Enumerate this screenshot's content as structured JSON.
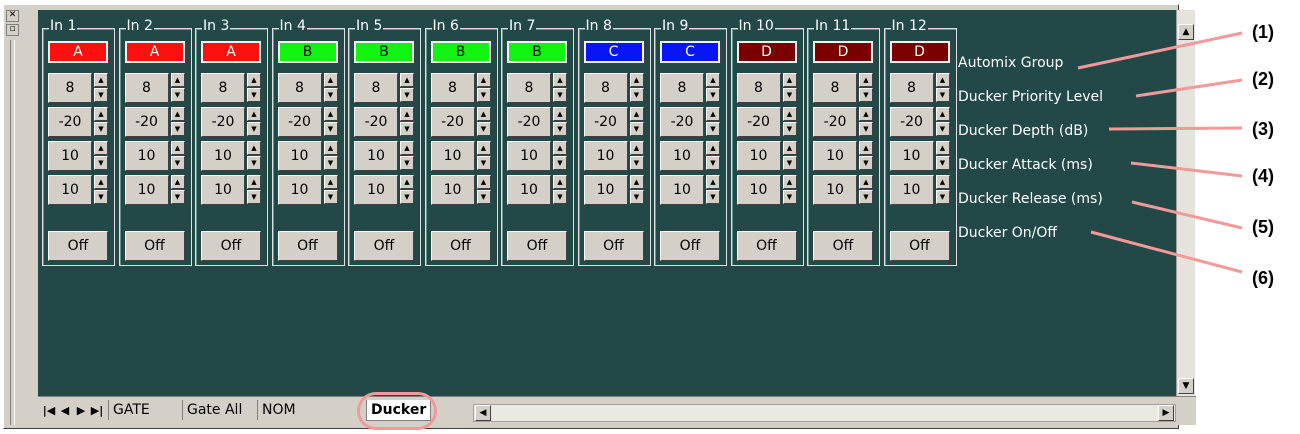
{
  "channels": [
    {
      "label": "In 1",
      "group": "A",
      "group_bg": "#ff1010",
      "group_fg": "#ffffff",
      "priority": "8",
      "depth": "-20",
      "attack": "10",
      "release": "10",
      "onoff": "Off"
    },
    {
      "label": "In 2",
      "group": "A",
      "group_bg": "#ff1010",
      "group_fg": "#ffffff",
      "priority": "8",
      "depth": "-20",
      "attack": "10",
      "release": "10",
      "onoff": "Off"
    },
    {
      "label": "In 3",
      "group": "A",
      "group_bg": "#ff1010",
      "group_fg": "#ffffff",
      "priority": "8",
      "depth": "-20",
      "attack": "10",
      "release": "10",
      "onoff": "Off"
    },
    {
      "label": "In 4",
      "group": "B",
      "group_bg": "#11f311",
      "group_fg": "#000000",
      "priority": "8",
      "depth": "-20",
      "attack": "10",
      "release": "10",
      "onoff": "Off"
    },
    {
      "label": "In 5",
      "group": "B",
      "group_bg": "#11f311",
      "group_fg": "#000000",
      "priority": "8",
      "depth": "-20",
      "attack": "10",
      "release": "10",
      "onoff": "Off"
    },
    {
      "label": "In 6",
      "group": "B",
      "group_bg": "#11f311",
      "group_fg": "#000000",
      "priority": "8",
      "depth": "-20",
      "attack": "10",
      "release": "10",
      "onoff": "Off"
    },
    {
      "label": "In 7",
      "group": "B",
      "group_bg": "#11f311",
      "group_fg": "#000000",
      "priority": "8",
      "depth": "-20",
      "attack": "10",
      "release": "10",
      "onoff": "Off"
    },
    {
      "label": "In 8",
      "group": "C",
      "group_bg": "#0a15f5",
      "group_fg": "#ffffff",
      "priority": "8",
      "depth": "-20",
      "attack": "10",
      "release": "10",
      "onoff": "Off"
    },
    {
      "label": "In 9",
      "group": "C",
      "group_bg": "#0a15f5",
      "group_fg": "#ffffff",
      "priority": "8",
      "depth": "-20",
      "attack": "10",
      "release": "10",
      "onoff": "Off"
    },
    {
      "label": "In 10",
      "group": "D",
      "group_bg": "#7a0000",
      "group_fg": "#ffffff",
      "priority": "8",
      "depth": "-20",
      "attack": "10",
      "release": "10",
      "onoff": "Off"
    },
    {
      "label": "In 11",
      "group": "D",
      "group_bg": "#7a0000",
      "group_fg": "#ffffff",
      "priority": "8",
      "depth": "-20",
      "attack": "10",
      "release": "10",
      "onoff": "Off"
    },
    {
      "label": "In 12",
      "group": "D",
      "group_bg": "#7a0000",
      "group_fg": "#ffffff",
      "priority": "8",
      "depth": "-20",
      "attack": "10",
      "release": "10",
      "onoff": "Off"
    }
  ],
  "row_labels": [
    "Automix Group",
    "Ducker Priority Level",
    "Ducker Depth (dB)",
    "Ducker Attack (ms)",
    "Ducker Release (ms)",
    "Ducker On/Off"
  ],
  "callouts": [
    "(1)",
    "(2)",
    "(3)",
    "(4)",
    "(5)",
    "(6)"
  ],
  "tabs": [
    {
      "label": "GATE",
      "active": false
    },
    {
      "label": "Gate All",
      "active": false
    },
    {
      "label": "NOM",
      "active": false
    },
    {
      "label": "Ducker",
      "active": true
    }
  ],
  "nav_buttons": [
    "first-sheet",
    "prev-sheet",
    "next-sheet",
    "last-sheet"
  ],
  "colors": {
    "client_bg": "#224848",
    "highlight_ring": "#f29999"
  }
}
